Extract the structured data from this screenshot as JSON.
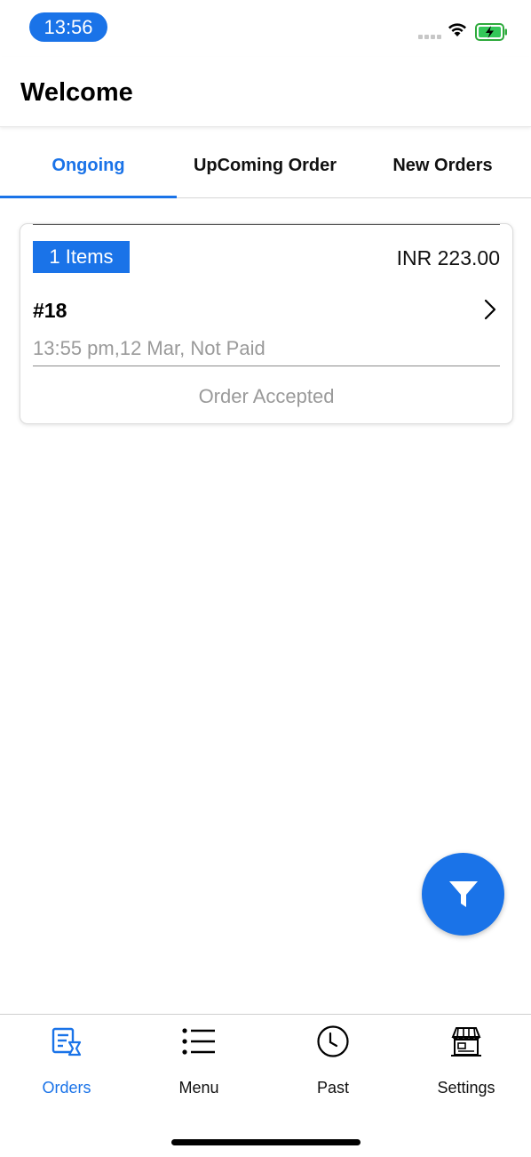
{
  "status_bar": {
    "time": "13:56"
  },
  "header": {
    "title": "Welcome"
  },
  "tabs": [
    {
      "label": "Ongoing",
      "active": true
    },
    {
      "label": "UpComing Order",
      "active": false
    },
    {
      "label": "New Orders",
      "active": false
    }
  ],
  "order": {
    "items_badge": "1 Items",
    "amount": "INR 223.00",
    "order_number": "#18",
    "meta": "13:55 pm,12 Mar, Not Paid",
    "status": "Order Accepted"
  },
  "bottom_nav": [
    {
      "label": "Orders",
      "icon": "orders-icon",
      "active": true
    },
    {
      "label": "Menu",
      "icon": "menu-list-icon",
      "active": false
    },
    {
      "label": "Past",
      "icon": "clock-icon",
      "active": false
    },
    {
      "label": "Settings",
      "icon": "store-icon",
      "active": false
    }
  ],
  "colors": {
    "accent": "#1a73e8",
    "muted_text": "#9a9a9a"
  }
}
